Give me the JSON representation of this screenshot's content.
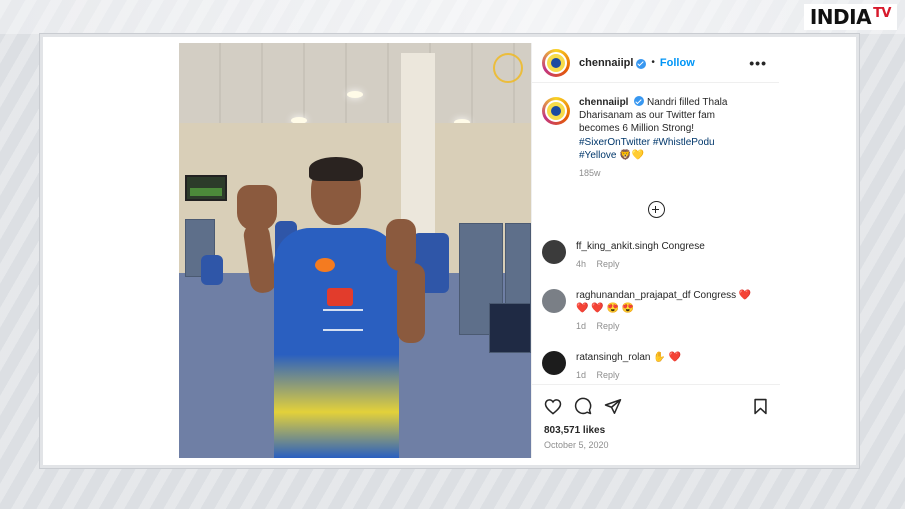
{
  "brand": {
    "logo_main": "INDIA",
    "logo_tv": "TV"
  },
  "post": {
    "header": {
      "username": "chennaiipl",
      "separator": "•",
      "follow_label": "Follow",
      "more_label": "•••"
    },
    "caption": {
      "username": "chennaiipl",
      "text": "Nandri filled Thala Dharisanam as our Twitter fam becomes 6 Million Strong!",
      "hashtags": [
        "#SixerOnTwitter",
        "#WhistlePodu",
        "#Yellove"
      ],
      "emoji": "🦁💛",
      "age": "185w"
    },
    "comments": [
      {
        "username": "ff_king_ankit.singh",
        "text": "Congrese",
        "age": "4h",
        "reply_label": "Reply",
        "avatar_color": "#3b3b3b"
      },
      {
        "username": "raghunandan_prajapat_df",
        "text": "Congress",
        "hearts": "❤️\n❤️ ❤️ 😍 😍",
        "age": "1d",
        "reply_label": "Reply",
        "avatar_color": "#7a7f86"
      },
      {
        "username": "ratansingh_rolan",
        "text": "✋ ❤️",
        "age": "1d",
        "reply_label": "Reply",
        "avatar_color": "#1c1c1c"
      }
    ],
    "footer": {
      "likes": "803,571 likes",
      "date": "October 5, 2020"
    }
  },
  "icons": [
    "heart-icon",
    "comment-icon",
    "share-icon",
    "bookmark-icon",
    "add-comment-icon",
    "verified-icon"
  ],
  "colors": {
    "accent": "#0095f6",
    "verified": "#3897f0",
    "heart": "#ed4956",
    "frame": "#e2e4e7"
  }
}
